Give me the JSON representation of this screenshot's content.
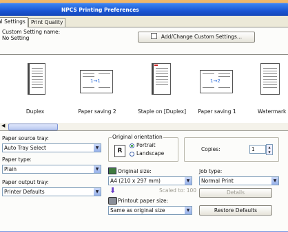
{
  "window": {
    "title": "NPCS Printing Preferences"
  },
  "tabs": [
    {
      "label": "al Settings",
      "active": true
    },
    {
      "label": "Print Quality",
      "active": false
    }
  ],
  "custom_setting": {
    "label": "Custom Setting name:",
    "value": "No Setting",
    "add_change_button": "Add/Change Custom Settings..."
  },
  "layout_strip": {
    "items": [
      {
        "label": "Duplex",
        "icon": "duplex-icon"
      },
      {
        "label": "Paper saving 2",
        "icon": "paper-saving-2-icon",
        "tag": "1→1"
      },
      {
        "label": "Staple on [Duplex]",
        "icon": "staple-icon"
      },
      {
        "label": "Paper saving 1",
        "icon": "paper-saving-1-icon",
        "tag": "1→2"
      },
      {
        "label": "Watermark R",
        "icon": "watermark-icon"
      }
    ]
  },
  "paper_source_tray": {
    "label": "Paper source tray:",
    "value": "Auto Tray Select"
  },
  "paper_type": {
    "label": "Paper type:",
    "value": "Plain"
  },
  "paper_output_tray": {
    "label": "Paper output tray:",
    "value": "Printer Defaults"
  },
  "orientation": {
    "label": "Original orientation",
    "options": [
      "Portrait",
      "Landscape"
    ],
    "selected": "Portrait",
    "glyph": "R"
  },
  "copies": {
    "label": "Copies:",
    "value": "1"
  },
  "original_size": {
    "label": "Original size:",
    "value": "A4 (210 x 297 mm)",
    "scale_text": "Scaled to: 100"
  },
  "printout_size": {
    "label": "Printout paper size:",
    "value": "Same as original size"
  },
  "job_type": {
    "label": "Job type:",
    "value": "Normal Print",
    "details_button": "Details"
  },
  "restore_button": "Restore Defaults",
  "colors": {
    "title_bar": "#1b56d4",
    "background": "#f0b86a",
    "accent_arrow": "#6a3ec8"
  }
}
